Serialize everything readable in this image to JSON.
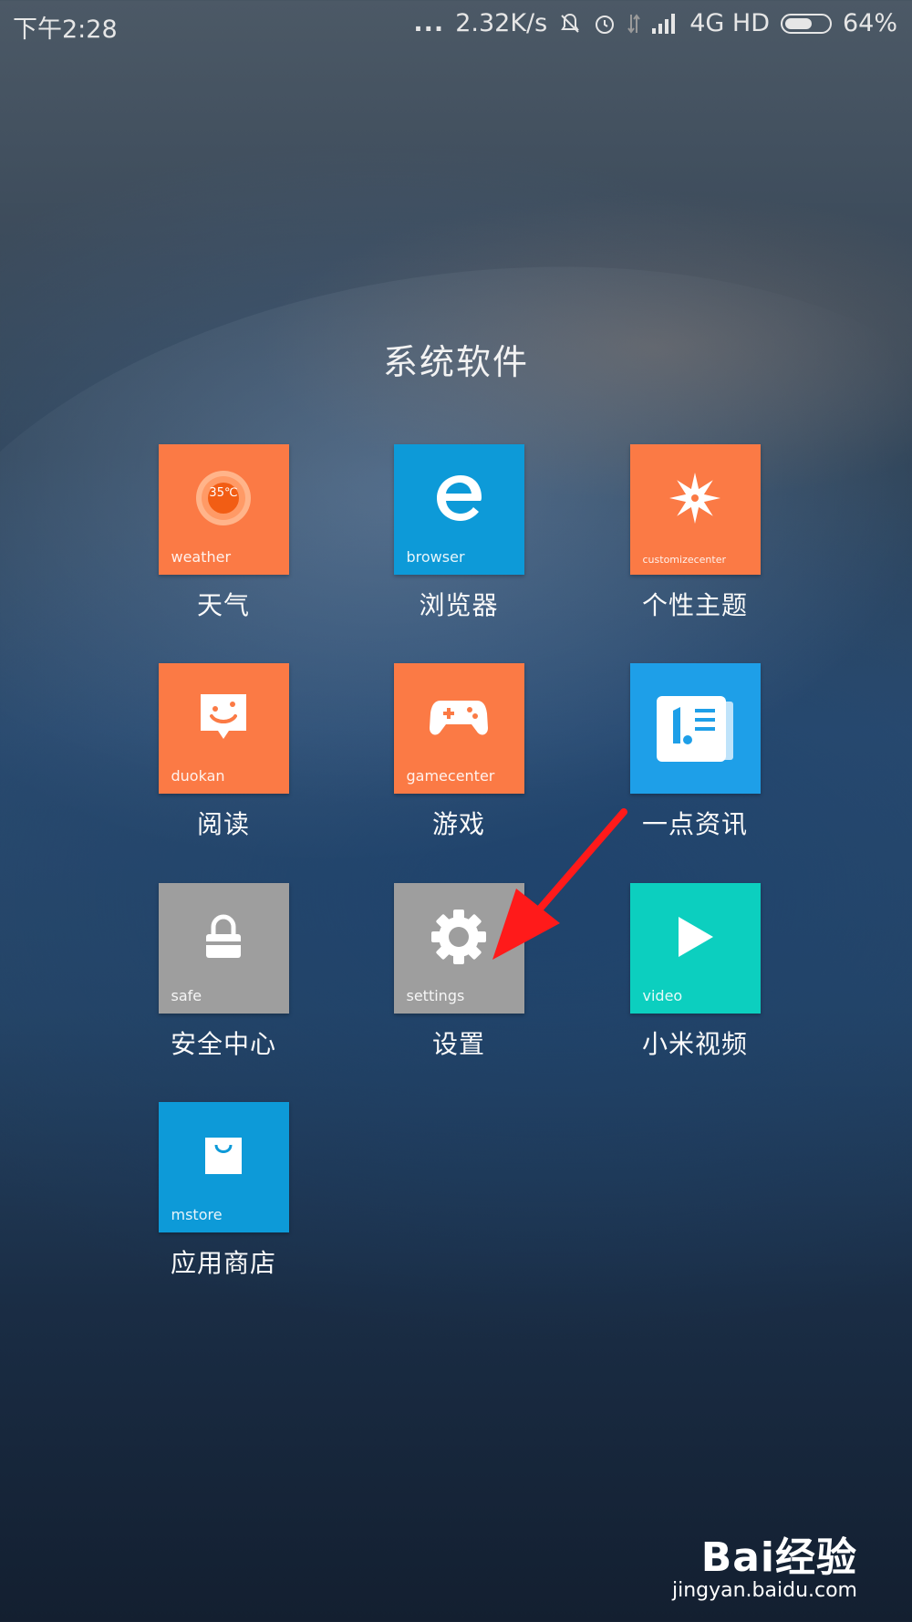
{
  "status_bar": {
    "time": "下午2:28",
    "dots": "...",
    "net_speed": "2.32K/s",
    "network": "4G HD",
    "battery_percent": "64%",
    "battery_level": 0.64
  },
  "folder": {
    "title": "系统软件",
    "apps": [
      {
        "label": "天气",
        "caption": "weather",
        "icon": "weather-icon",
        "color": "#fb7a45",
        "temp": "35℃"
      },
      {
        "label": "浏览器",
        "caption": "browser",
        "icon": "browser-icon",
        "color": "#0d9ad8"
      },
      {
        "label": "个性主题",
        "caption": "customizecenter",
        "icon": "theme-icon",
        "color": "#fb7a45"
      },
      {
        "label": "阅读",
        "caption": "duokan",
        "icon": "reader-icon",
        "color": "#fb7a45"
      },
      {
        "label": "游戏",
        "caption": "gamecenter",
        "icon": "gamepad-icon",
        "color": "#fb7a45"
      },
      {
        "label": "一点资讯",
        "caption": "",
        "icon": "news-icon",
        "color": "#1e9fe8"
      },
      {
        "label": "安全中心",
        "caption": "safe",
        "icon": "lock-icon",
        "color": "#9e9e9e"
      },
      {
        "label": "设置",
        "caption": "settings",
        "icon": "gear-icon",
        "color": "#9e9e9e"
      },
      {
        "label": "小米视频",
        "caption": "video",
        "icon": "play-icon",
        "color": "#0ccfbf"
      },
      {
        "label": "应用商店",
        "caption": "mstore",
        "icon": "shopping-bag-icon",
        "color": "#0d9ad8"
      }
    ]
  },
  "annotation": {
    "arrow_color": "#ff1a1a"
  },
  "watermark": {
    "logo": "Bai经验",
    "url": "jingyan.baidu.com"
  }
}
